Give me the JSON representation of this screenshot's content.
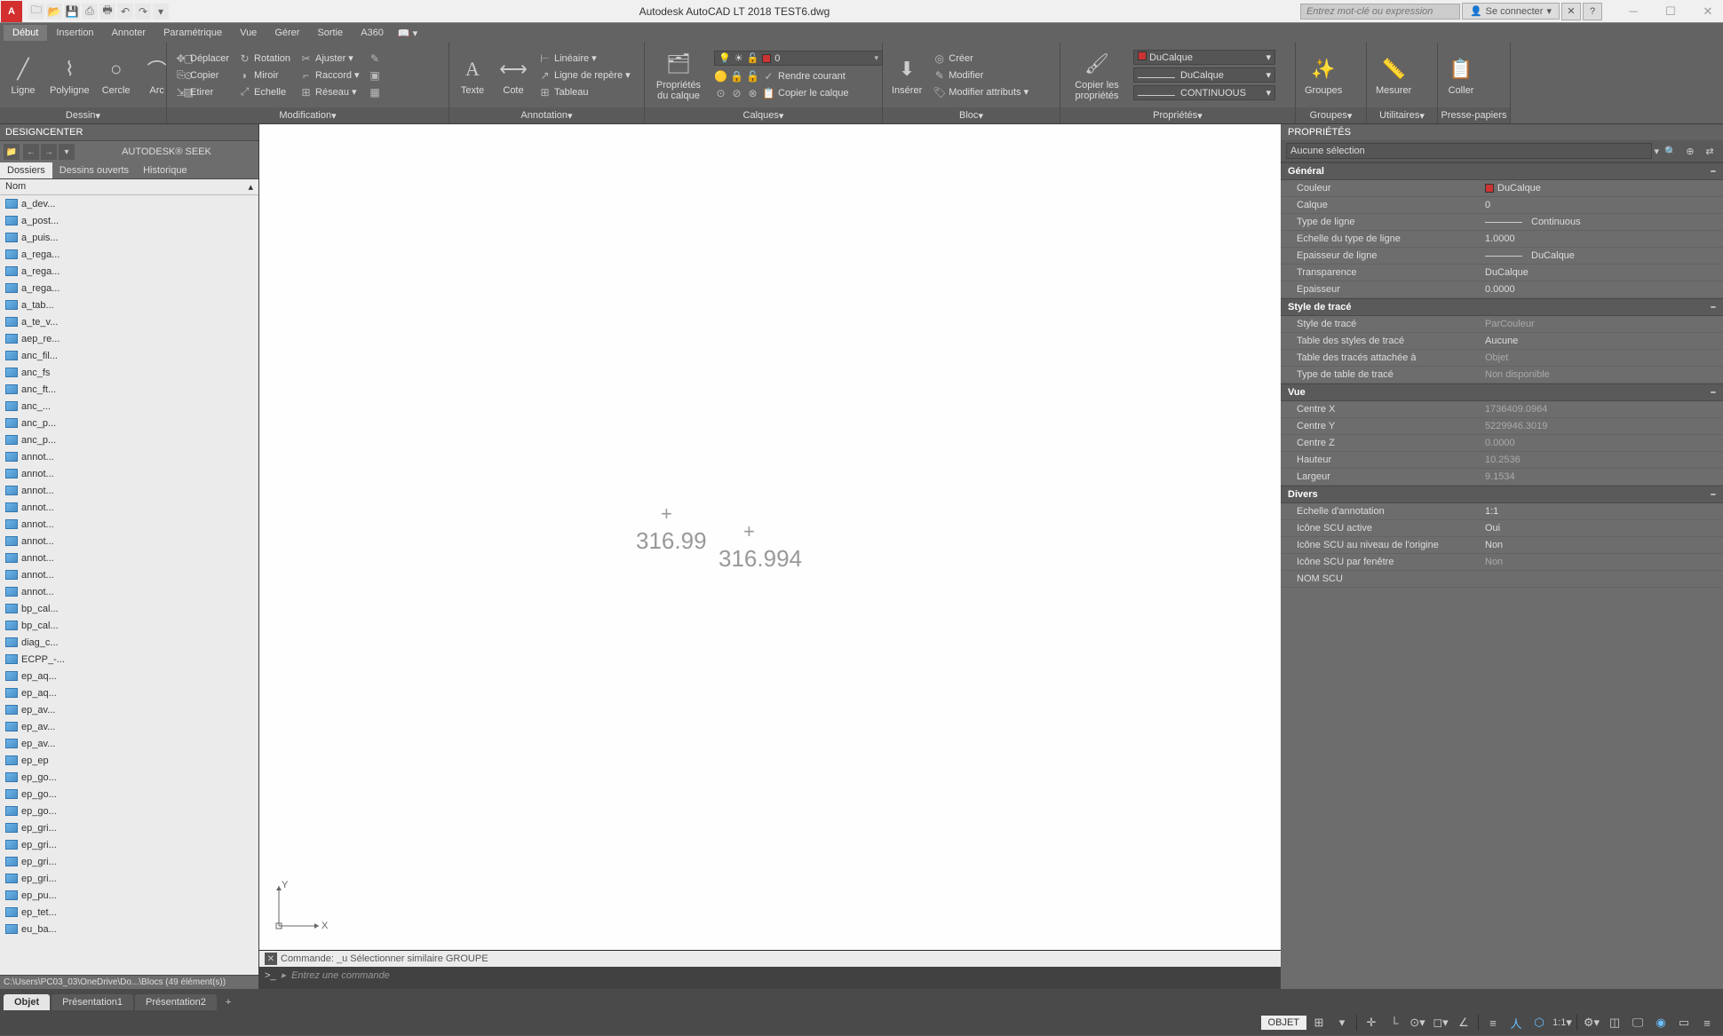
{
  "titlebar": {
    "app_letter": "A",
    "title": "Autodesk AutoCAD LT 2018    TEST6.dwg",
    "search_placeholder": "Entrez mot-clé ou expression",
    "login_label": "Se connecter"
  },
  "menubar": {
    "tabs": [
      "Début",
      "Insertion",
      "Annoter",
      "Paramétrique",
      "Vue",
      "Gérer",
      "Sortie",
      "A360"
    ]
  },
  "ribbon": {
    "draw": {
      "line": "Ligne",
      "polyline": "Polyligne",
      "circle": "Cercle",
      "arc": "Arc",
      "panel": "Dessin"
    },
    "modify": {
      "move": "Déplacer",
      "rotate": "Rotation",
      "trim": "Ajuster",
      "copy": "Copier",
      "mirror": "Miroir",
      "fillet": "Raccord",
      "stretch": "Etirer",
      "scale": "Echelle",
      "array": "Réseau",
      "panel": "Modification"
    },
    "annot": {
      "text": "Texte",
      "dim": "Cote",
      "linear": "Linéaire",
      "leader": "Ligne de repère",
      "table": "Tableau",
      "panel": "Annotation"
    },
    "layers": {
      "props": "Propriétés du calque",
      "layer_dd_value": "0",
      "make_current": "Rendre courant",
      "match": "Copier le calque",
      "panel": "Calques"
    },
    "block": {
      "insert": "Insérer",
      "create": "Créer",
      "edit": "Modifier",
      "edit_attr": "Modifier attributs",
      "panel": "Bloc"
    },
    "props": {
      "match": "Copier les propriétés",
      "bylayer": "DuCalque",
      "continuous": "CONTINUOUS",
      "panel": "Propriétés"
    },
    "groups": {
      "label": "Groupes",
      "panel": "Groupes"
    },
    "measure": {
      "label": "Mesurer",
      "panel": "Utilitaires"
    },
    "clip": {
      "label": "Coller",
      "panel": "Presse-papiers"
    }
  },
  "designcenter": {
    "header": "DESIGNCENTER",
    "seek": "AUTODESK® SEEK",
    "tabs": [
      "Dossiers",
      "Dessins ouverts",
      "Historique"
    ],
    "col_header": "Nom",
    "items": [
      "a_dev...",
      "a_post...",
      "a_puis...",
      "a_rega...",
      "a_rega...",
      "a_rega...",
      "a_tab...",
      "a_te_v...",
      "aep_re...",
      "anc_fil...",
      "anc_fs",
      "anc_ft...",
      "anc_...",
      "anc_p...",
      "anc_p...",
      "annot...",
      "annot...",
      "annot...",
      "annot...",
      "annot...",
      "annot...",
      "annot...",
      "annot...",
      "annot...",
      "bp_cal...",
      "bp_cal...",
      "diag_c...",
      "ECPP_-...",
      "ep_aq...",
      "ep_aq...",
      "ep_av...",
      "ep_av...",
      "ep_av...",
      "ep_ep",
      "ep_go...",
      "ep_go...",
      "ep_go...",
      "ep_gri...",
      "ep_gri...",
      "ep_gri...",
      "ep_gri...",
      "ep_pu...",
      "ep_tet...",
      "eu_ba..."
    ],
    "status": "C:\\Users\\PC03_03\\OneDrive\\Do...\\Blocs (49 élément(s))"
  },
  "canvas": {
    "text1": "316.99",
    "text2": "316.994"
  },
  "cmd": {
    "history": "Commande: _u Sélectionner similaire GROUPE",
    "prompt_icon": ">_",
    "placeholder": "Entrez une commande"
  },
  "properties": {
    "header": "PROPRIÉTÉS",
    "selector": "Aucune sélection",
    "sections": {
      "general": {
        "title": "Général",
        "rows": [
          {
            "label": "Couleur",
            "value": "DuCalque",
            "swatch": true
          },
          {
            "label": "Calque",
            "value": "0"
          },
          {
            "label": "Type de ligne",
            "value": "Continuous",
            "line": true
          },
          {
            "label": "Echelle du type de ligne",
            "value": "1.0000"
          },
          {
            "label": "Epaisseur de ligne",
            "value": "DuCalque",
            "line": true
          },
          {
            "label": "Transparence",
            "value": "DuCalque"
          },
          {
            "label": "Epaisseur",
            "value": "0.0000"
          }
        ]
      },
      "plot": {
        "title": "Style de tracé",
        "rows": [
          {
            "label": "Style de tracé",
            "value": "ParCouleur",
            "readonly": true
          },
          {
            "label": "Table des styles de tracé",
            "value": "Aucune"
          },
          {
            "label": "Table des tracés attachée à",
            "value": "Objet",
            "readonly": true
          },
          {
            "label": "Type de table de tracé",
            "value": "Non disponible",
            "readonly": true
          }
        ]
      },
      "view": {
        "title": "Vue",
        "rows": [
          {
            "label": "Centre X",
            "value": "1736409.0964",
            "readonly": true
          },
          {
            "label": "Centre Y",
            "value": "5229946.3019",
            "readonly": true
          },
          {
            "label": "Centre Z",
            "value": "0.0000",
            "readonly": true
          },
          {
            "label": "Hauteur",
            "value": "10.2536",
            "readonly": true
          },
          {
            "label": "Largeur",
            "value": "9.1534",
            "readonly": true
          }
        ]
      },
      "misc": {
        "title": "Divers",
        "rows": [
          {
            "label": "Echelle d'annotation",
            "value": "1:1"
          },
          {
            "label": "Icône SCU active",
            "value": "Oui"
          },
          {
            "label": "Icône SCU au niveau de l'origine",
            "value": "Non"
          },
          {
            "label": "Icône SCU par fenêtre",
            "value": "Non",
            "readonly": true
          },
          {
            "label": "NOM SCU",
            "value": ""
          }
        ]
      }
    }
  },
  "layout_tabs": [
    "Objet",
    "Présentation1",
    "Présentation2"
  ],
  "statusbar": {
    "model": "OBJET",
    "scale": "1:1"
  }
}
